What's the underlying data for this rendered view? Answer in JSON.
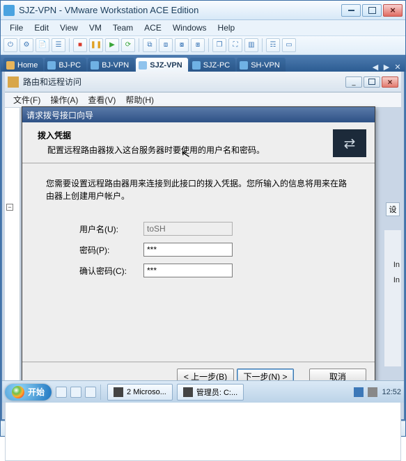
{
  "window": {
    "title": "SJZ-VPN - VMware Workstation ACE Edition"
  },
  "menubar": [
    "File",
    "Edit",
    "View",
    "VM",
    "Team",
    "ACE",
    "Windows",
    "Help"
  ],
  "tabs": {
    "items": [
      {
        "label": "Home"
      },
      {
        "label": "BJ-PC"
      },
      {
        "label": "BJ-VPN"
      },
      {
        "label": "SJZ-VPN"
      },
      {
        "label": "SJZ-PC"
      },
      {
        "label": "SH-VPN"
      }
    ],
    "active_index": 3
  },
  "rras": {
    "title": "路由和远程访问",
    "menu": [
      "文件(F)",
      "操作(A)",
      "查看(V)",
      "帮助(H)"
    ]
  },
  "wizard": {
    "title": "请求拨号接口向导",
    "header_title": "拨入凭据",
    "header_sub": "配置远程路由器拨入这台服务器时要使用的用户名和密码。",
    "body_desc": "您需要设置远程路由器用来连接到此接口的拨入凭据。您所输入的信息将用来在路由器上创建用户帐户。",
    "labels": {
      "username": "用户名(U):",
      "password": "密码(P):",
      "confirm": "确认密码(C):"
    },
    "values": {
      "username": "toSH",
      "password": "***",
      "confirm": "***"
    },
    "buttons": {
      "back": "< 上一步(B)",
      "next": "下一步(N) >",
      "cancel": "取消"
    }
  },
  "side": {
    "btn": "设",
    "text1": "In",
    "text2": "In"
  },
  "taskbar": {
    "start": "开始",
    "items": [
      {
        "label": "2 Microso..."
      },
      {
        "label": "管理员: C:..."
      }
    ],
    "clock": "12:52"
  },
  "colors": {
    "accent": "#2e5186"
  }
}
